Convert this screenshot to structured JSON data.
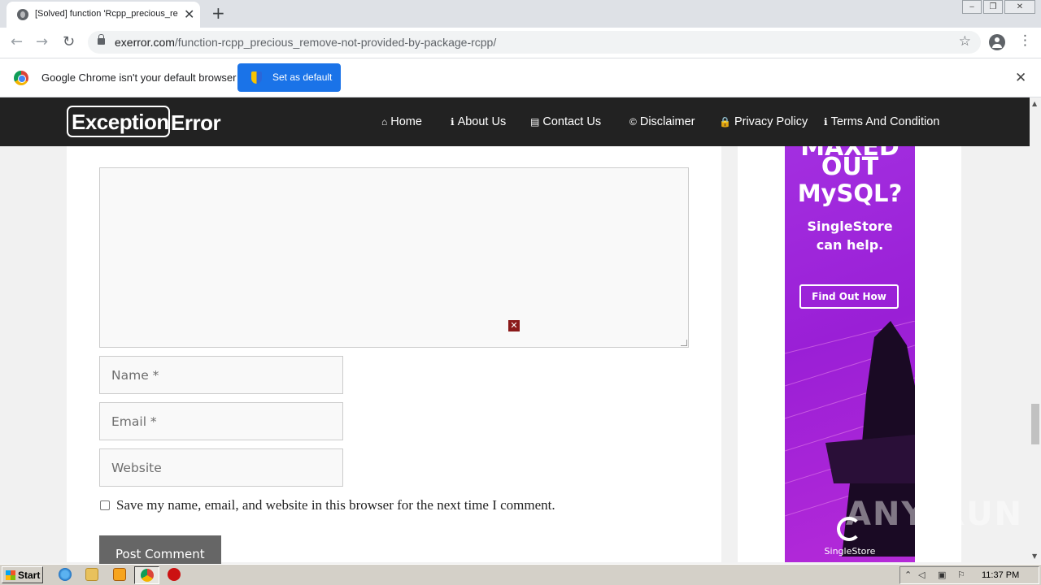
{
  "browser": {
    "tab_title": "[Solved] function 'Rcpp_precious_re",
    "tab_close": "✕",
    "new_tab": "+",
    "url_host": "exerror.com",
    "url_path": "/function-rcpp_precious_remove-not-provided-by-package-rcpp/",
    "back_icon": "←",
    "forward_icon": "→",
    "reload_icon": "↻",
    "star_icon": "☆",
    "menu_icon": "⋮"
  },
  "infobar": {
    "message": "Google Chrome isn't your default browser",
    "button_label": "Set as default",
    "close": "✕"
  },
  "site": {
    "logo_boxed": "Exception",
    "logo_rest": "Error",
    "nav": [
      {
        "icon": "⌂",
        "label": "Home"
      },
      {
        "icon": "ℹ",
        "label": "About Us"
      },
      {
        "icon": "▤",
        "label": "Contact Us"
      },
      {
        "icon": "©",
        "label": "Disclaimer"
      },
      {
        "icon": "🔒",
        "label": "Privacy Policy"
      },
      {
        "icon": "ℹ",
        "label": "Terms And Condition"
      }
    ]
  },
  "comment_form": {
    "ad_close": "✕",
    "name_placeholder": "Name *",
    "email_placeholder": "Email *",
    "website_placeholder": "Website",
    "save_label": "Save my name, email, and website in this browser for the next time I comment.",
    "submit_label": "Post Comment"
  },
  "ad": {
    "line1": "MAXED",
    "line2": "OUT",
    "line3": "MySQL?",
    "line4": "SingleStore",
    "line5": "can help.",
    "cta": "Find Out How",
    "brand": "SingleStore",
    "bg_color": "#a32fe0"
  },
  "watermark": "ANY RUN",
  "taskbar": {
    "start_label": "Start",
    "clock": "11:37 PM"
  }
}
